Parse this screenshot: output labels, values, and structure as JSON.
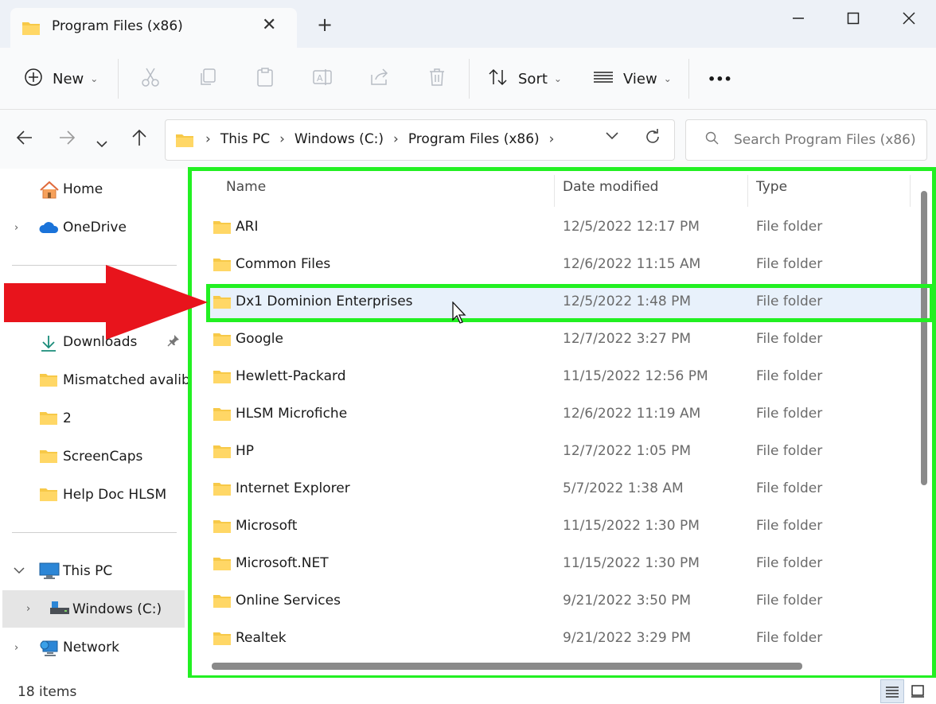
{
  "window": {
    "tab_title": "Program Files (x86)",
    "tab_close": "✕",
    "new_tab": "+"
  },
  "toolbar": {
    "new_label": "New",
    "sort_label": "Sort",
    "view_label": "View",
    "more_label": "•••"
  },
  "address": {
    "crumbs": [
      "This PC",
      "Windows (C:)",
      "Program Files (x86)"
    ],
    "search_placeholder": "Search Program Files (x86)"
  },
  "sidebar": {
    "items": [
      {
        "label": "Home",
        "icon": "home-icon"
      },
      {
        "label": "OneDrive",
        "icon": "onedrive-icon"
      },
      {
        "label": "Downloads",
        "icon": "download-icon",
        "pinned": true
      },
      {
        "label": "Mismatched avalibility",
        "icon": "folder-icon"
      },
      {
        "label": "2",
        "icon": "folder-icon"
      },
      {
        "label": "ScreenCaps",
        "icon": "folder-icon"
      },
      {
        "label": "Help Doc HLSM",
        "icon": "folder-icon"
      },
      {
        "label": "This PC",
        "icon": "pc-icon"
      },
      {
        "label": "Windows  (C:)",
        "icon": "drive-icon",
        "selected": true
      },
      {
        "label": "Network",
        "icon": "network-icon"
      }
    ]
  },
  "filelist": {
    "columns": {
      "name": "Name",
      "date": "Date modified",
      "type": "Type"
    },
    "rows": [
      {
        "name": "ARI",
        "date": "12/5/2022 12:17 PM",
        "type": "File folder"
      },
      {
        "name": "Common Files",
        "date": "12/6/2022 11:15 AM",
        "type": "File folder"
      },
      {
        "name": "Dx1 Dominion Enterprises",
        "date": "12/5/2022 1:48 PM",
        "type": "File folder",
        "highlighted": true
      },
      {
        "name": "Google",
        "date": "12/7/2022 3:27 PM",
        "type": "File folder"
      },
      {
        "name": "Hewlett-Packard",
        "date": "11/15/2022 12:56 PM",
        "type": "File folder"
      },
      {
        "name": "HLSM Microfiche",
        "date": "12/6/2022 11:19 AM",
        "type": "File folder"
      },
      {
        "name": "HP",
        "date": "12/7/2022 1:05 PM",
        "type": "File folder"
      },
      {
        "name": "Internet Explorer",
        "date": "5/7/2022 1:38 AM",
        "type": "File folder"
      },
      {
        "name": "Microsoft",
        "date": "11/15/2022 1:30 PM",
        "type": "File folder"
      },
      {
        "name": "Microsoft.NET",
        "date": "11/15/2022 1:30 PM",
        "type": "File folder"
      },
      {
        "name": "Online Services",
        "date": "9/21/2022 3:50 PM",
        "type": "File folder"
      },
      {
        "name": "Realtek",
        "date": "9/21/2022 3:29 PM",
        "type": "File folder"
      }
    ]
  },
  "status": {
    "item_count": "18 items"
  },
  "colors": {
    "annotation_green": "#22f022",
    "annotation_red": "#e8141c",
    "folder_yellow": "#f7c948",
    "selection_blue": "#e8f1fb"
  }
}
